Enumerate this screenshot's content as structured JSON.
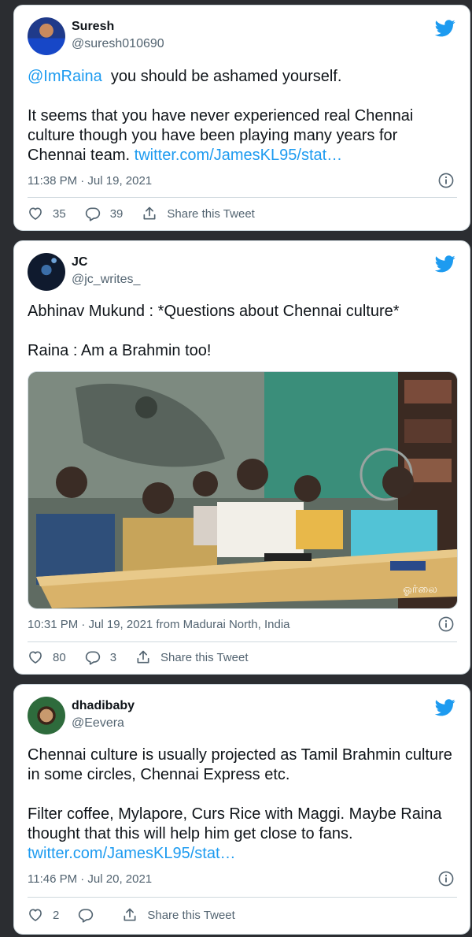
{
  "tweets": [
    {
      "name": "Suresh",
      "handle": "@suresh010690",
      "mention": "@ImRaina",
      "line1_rest": "  you should be ashamed yourself.",
      "para2": "It seems that you have never experienced real Chennai culture though you have been playing  many years for Chennai team.",
      "link": "twitter.com/JamesKL95/stat…",
      "meta": "11:38 PM · Jul 19, 2021",
      "likes": "35",
      "replies": "39",
      "share": "Share this Tweet"
    },
    {
      "name": "JC",
      "handle": "@jc_writes_",
      "para1": "Abhinav Mukund : *Questions about Chennai culture*",
      "para2": "Raina : Am a Brahmin too!",
      "meta": "10:31 PM · Jul 19, 2021 from Madurai North, India",
      "likes": "80",
      "replies": "3",
      "share": "Share this Tweet",
      "photo_watermark": "ஓர்லை"
    },
    {
      "name": "dhadibaby",
      "handle": "@Eevera",
      "para1": "Chennai culture is usually projected as Tamil Brahmin culture in some circles, Chennai Express etc.",
      "para2": "Filter coffee, Mylapore, Curs Rice with Maggi. Maybe Raina thought that this will help him get close to fans.",
      "link": "twitter.com/JamesKL95/stat…",
      "meta": "11:46 PM · Jul 20, 2021",
      "likes": "2",
      "replies": "",
      "share": "Share this Tweet"
    }
  ],
  "colors": {
    "link": "#1d9bf0",
    "twitter_blue": "#1d9bf0",
    "secondary_text": "#536471",
    "background": "#2b2d31"
  },
  "icons": [
    "twitter-bird-icon",
    "info-icon",
    "heart-icon",
    "reply-icon",
    "share-icon"
  ]
}
